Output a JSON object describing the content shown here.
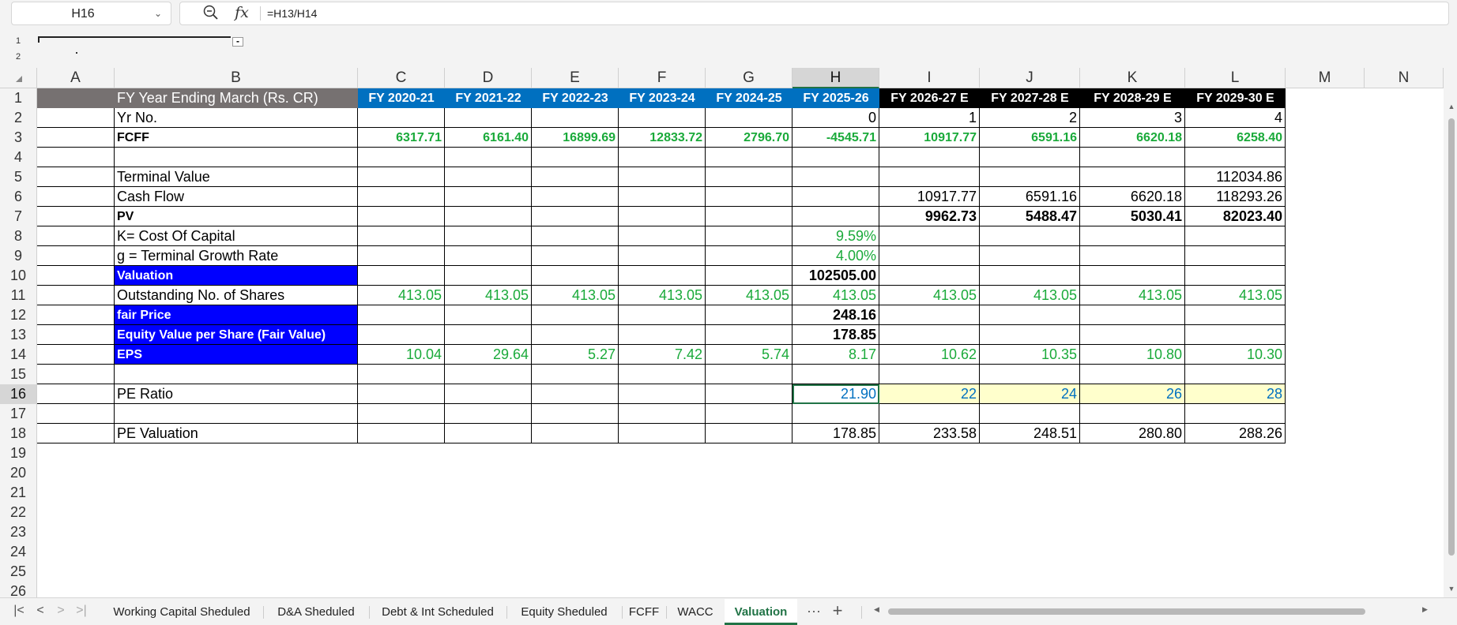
{
  "formula_bar": {
    "name_box": "H16",
    "formula": "=H13/H14",
    "fx_label": "fx"
  },
  "outline": {
    "levels": [
      "1",
      "2"
    ],
    "collapse_btn": "-"
  },
  "columns": [
    "A",
    "B",
    "C",
    "D",
    "E",
    "F",
    "G",
    "H",
    "I",
    "J",
    "K",
    "L",
    "M",
    "N"
  ],
  "row_numbers": [
    "1",
    "2",
    "3",
    "4",
    "5",
    "6",
    "7",
    "8",
    "9",
    "10",
    "11",
    "12",
    "13",
    "14",
    "15",
    "16",
    "17",
    "18",
    "19",
    "20",
    "21",
    "22",
    "23",
    "24",
    "25",
    "26"
  ],
  "sheet": {
    "header_label": "FY Year Ending March (Rs. CR)",
    "years": [
      "FY 2020-21",
      "FY 2021-22",
      "FY 2022-23",
      "FY 2023-24",
      "FY 2024-25",
      "FY 2025-26",
      "FY 2026-27 E",
      "FY 2027-28 E",
      "FY 2028-29 E",
      "FY 2029-30 E"
    ],
    "yr_no": {
      "label": "Yr No.",
      "values": [
        "",
        "",
        "",
        "",
        "",
        "0",
        "1",
        "2",
        "3",
        "4"
      ]
    },
    "fcff": {
      "label": "FCFF",
      "values": [
        "6317.71",
        "6161.40",
        "16899.69",
        "12833.72",
        "2796.70",
        "-4545.71",
        "10917.77",
        "6591.16",
        "6620.18",
        "6258.40"
      ]
    },
    "terminal_value": {
      "label": "Terminal Value",
      "values": [
        "",
        "",
        "",
        "",
        "",
        "",
        "",
        "",
        "",
        "112034.86"
      ]
    },
    "cash_flow": {
      "label": "Cash Flow",
      "values": [
        "",
        "",
        "",
        "",
        "",
        "",
        "10917.77",
        "6591.16",
        "6620.18",
        "118293.26"
      ]
    },
    "pv": {
      "label": "PV",
      "values": [
        "",
        "",
        "",
        "",
        "",
        "",
        "9962.73",
        "5488.47",
        "5030.41",
        "82023.40"
      ]
    },
    "k": {
      "label": "K= Cost Of Capital",
      "values": [
        "",
        "",
        "",
        "",
        "",
        "9.59%",
        "",
        "",
        "",
        ""
      ]
    },
    "g": {
      "label": "g = Terminal Growth Rate",
      "values": [
        "",
        "",
        "",
        "",
        "",
        "4.00%",
        "",
        "",
        "",
        ""
      ]
    },
    "valuation": {
      "label": "Valuation",
      "values": [
        "",
        "",
        "",
        "",
        "",
        "102505.00",
        "",
        "",
        "",
        ""
      ]
    },
    "shares": {
      "label": "Outstanding No. of Shares",
      "values": [
        "413.05",
        "413.05",
        "413.05",
        "413.05",
        "413.05",
        "413.05",
        "413.05",
        "413.05",
        "413.05",
        "413.05"
      ]
    },
    "fair_price": {
      "label": "fair Price",
      "values": [
        "",
        "",
        "",
        "",
        "",
        "248.16",
        "",
        "",
        "",
        ""
      ]
    },
    "equity_value": {
      "label": "Equity Value per Share (Fair Value)",
      "values": [
        "",
        "",
        "",
        "",
        "",
        "178.85",
        "",
        "",
        "",
        ""
      ]
    },
    "eps": {
      "label": "EPS",
      "values": [
        "10.04",
        "29.64",
        "5.27",
        "7.42",
        "5.74",
        "8.17",
        "10.62",
        "10.35",
        "10.80",
        "10.30"
      ]
    },
    "pe_ratio": {
      "label": "PE Ratio",
      "values": [
        "",
        "",
        "",
        "",
        "",
        "21.90",
        "22",
        "24",
        "26",
        "28"
      ]
    },
    "pe_valuation": {
      "label": "PE Valuation",
      "values": [
        "",
        "",
        "",
        "",
        "",
        "178.85",
        "233.58",
        "248.51",
        "280.80",
        "288.26"
      ]
    }
  },
  "tabs": [
    "Working Capital Sheduled",
    "D&A Sheduled",
    "Debt & Int Scheduled",
    "Equity Sheduled",
    "FCFF",
    "WACC",
    "Valuation"
  ],
  "active_tab": "Valuation",
  "tab_more": "···",
  "tab_add": "+",
  "nav": {
    "first": "|<",
    "prev": "<",
    "next": ">",
    "last": ">|"
  },
  "colors": {
    "accent": "#217346",
    "header_blue": "#0070c0",
    "valuation_blue": "#0000ff",
    "green_values": "#1aaa3a"
  }
}
